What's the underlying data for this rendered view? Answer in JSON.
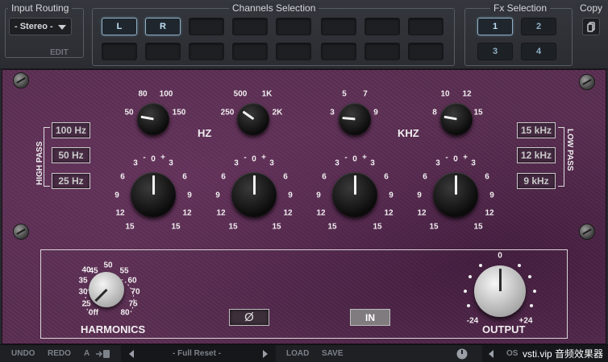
{
  "topbar": {
    "input_routing": {
      "title": "Input Routing",
      "value": "- Stereo -",
      "edit": "EDIT"
    },
    "channels": {
      "title": "Channels Selection",
      "left": "L",
      "right": "R"
    },
    "fx": {
      "title": "Fx Selection",
      "buttons": [
        "1",
        "2",
        "3",
        "4"
      ]
    },
    "copy": {
      "title": "Copy"
    }
  },
  "eq": {
    "unit_hz": "HZ",
    "unit_khz": "KHZ",
    "freq_knobs": [
      {
        "labels": [
          "50",
          "80",
          "100",
          "150"
        ]
      },
      {
        "labels": [
          "250",
          "500",
          "1K",
          "2K"
        ]
      },
      {
        "labels": [
          "3",
          "5",
          "7",
          "9"
        ]
      },
      {
        "labels": [
          "8",
          "10",
          "12",
          "15"
        ]
      }
    ],
    "gain_scale": [
      "15",
      "12",
      "9",
      "6",
      "3",
      "-",
      "0",
      "+",
      "3",
      "6",
      "9",
      "12",
      "15"
    ],
    "high_pass": {
      "label": "HIGH PASS",
      "buttons": [
        "100 Hz",
        "50 Hz",
        "25 Hz"
      ]
    },
    "low_pass": {
      "label": "LOW PASS",
      "buttons": [
        "15 kHz",
        "12 kHz",
        "9 kHz"
      ]
    }
  },
  "harmonics": {
    "label": "HARMONICS",
    "scale": [
      "0ff",
      "25",
      "30",
      "35",
      "40",
      "45",
      "50",
      "55",
      "60",
      "70",
      "75",
      "80"
    ]
  },
  "phase": {
    "label": "Ø"
  },
  "in_button": {
    "label": "IN"
  },
  "output": {
    "label": "OUTPUT",
    "min": "-24",
    "max": "+24",
    "center": "0"
  },
  "toolbar": {
    "undo": "UNDO",
    "redo": "REDO",
    "ab": "A",
    "copy_icon": "copy-to-icon",
    "preset": "- Full Reset -",
    "load": "LOAD",
    "save": "SAVE",
    "os": "OS",
    "watermark": "vsti.vip 音频效果器"
  }
}
